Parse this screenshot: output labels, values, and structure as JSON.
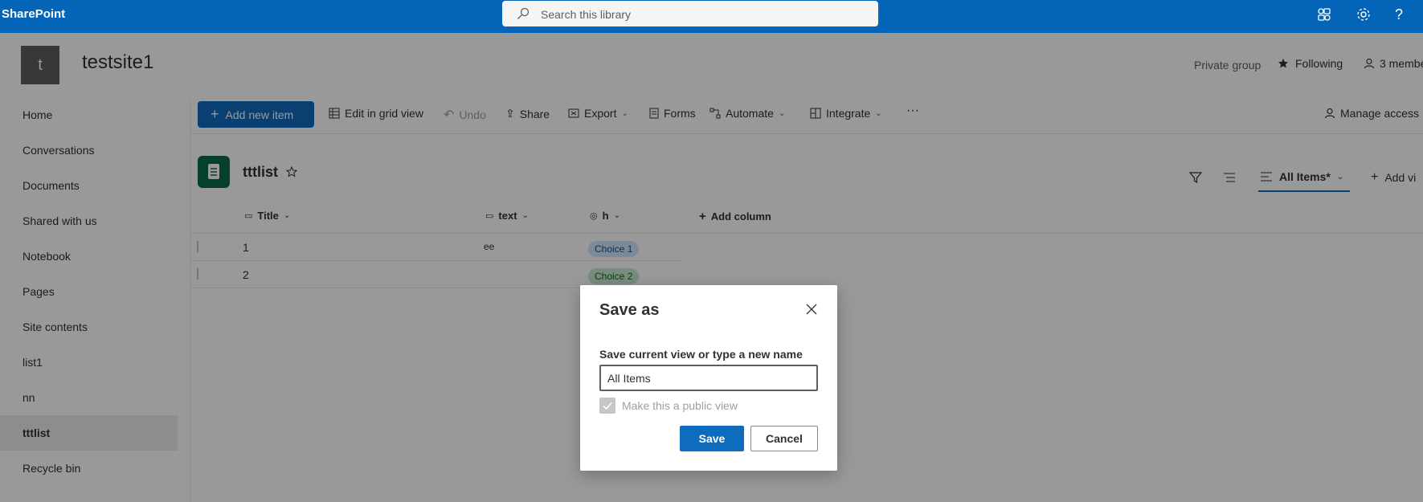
{
  "suite": {
    "brand": "SharePoint",
    "search_placeholder": "Search this library"
  },
  "site": {
    "logo_letter": "t",
    "title": "testsite1",
    "privacy": "Private group",
    "following": "Following",
    "members": "3 membe"
  },
  "nav": {
    "items": [
      {
        "label": "Home"
      },
      {
        "label": "Conversations"
      },
      {
        "label": "Documents"
      },
      {
        "label": "Shared with us"
      },
      {
        "label": "Notebook"
      },
      {
        "label": "Pages"
      },
      {
        "label": "Site contents"
      },
      {
        "label": "list1"
      },
      {
        "label": "nn"
      },
      {
        "label": "tttlist"
      },
      {
        "label": "Recycle bin"
      }
    ],
    "selected": "tttlist"
  },
  "commands": {
    "add_new": "Add new item",
    "edit_grid": "Edit in grid view",
    "undo": "Undo",
    "share": "Share",
    "export": "Export",
    "forms": "Forms",
    "automate": "Automate",
    "integrate": "Integrate",
    "more": "···",
    "manage_access": "Manage access"
  },
  "list": {
    "title": "tttlist",
    "view_name": "All Items*",
    "add_view": "Add vi",
    "columns": {
      "title": "Title",
      "text": "text",
      "h": "h",
      "add_column": "Add column"
    },
    "rows": [
      {
        "title": "1",
        "text": "ee",
        "h": "Choice 1"
      },
      {
        "title": "2",
        "text": "",
        "h": "Choice 2"
      }
    ]
  },
  "dialog": {
    "title": "Save as",
    "label": "Save current view or type a new name",
    "input_value": "All Items",
    "checkbox_label": "Make this a public view",
    "checkbox_checked": true,
    "save": "Save",
    "cancel": "Cancel"
  },
  "colors": {
    "suite_bar": "#0364b8",
    "primary": "#0f6cbd",
    "list_icon": "#0b6a4c",
    "choice1": "#cfe4fa",
    "choice2": "#caead8"
  }
}
